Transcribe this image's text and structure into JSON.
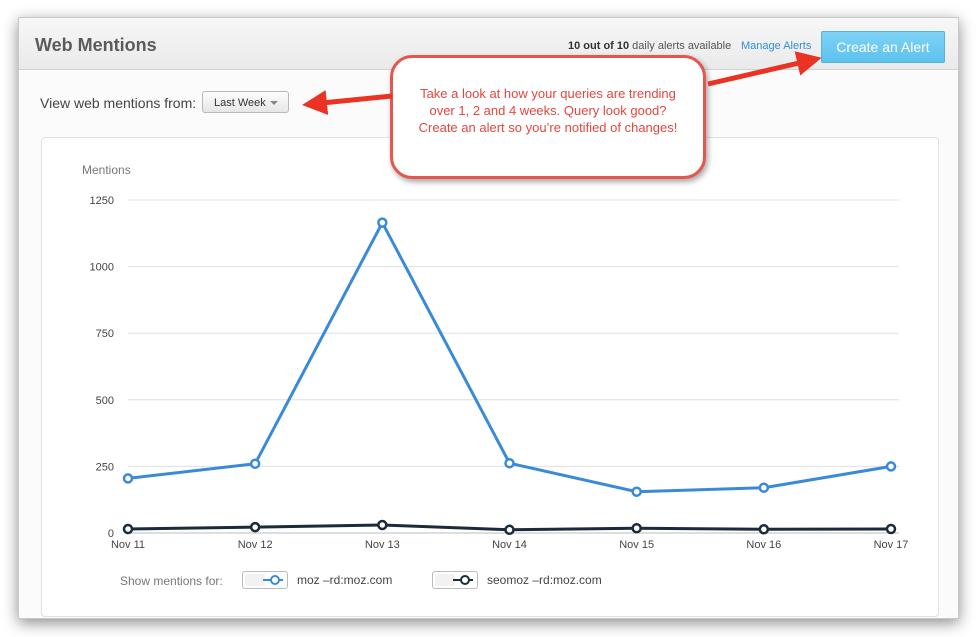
{
  "header": {
    "title": "Web Mentions",
    "quota_count": "10 out of 10",
    "quota_suffix": " daily alerts available",
    "manage_link": "Manage Alerts",
    "create_button": "Create an Alert"
  },
  "filter": {
    "label": "View web mentions from:",
    "selected": "Last Week"
  },
  "callout": {
    "text": "Take a look at how your queries are trending over 1, 2 and 4 weeks. Query look good? Create an alert so you’re notified of changes!"
  },
  "chart_data": {
    "type": "line",
    "title": "",
    "xlabel": "",
    "ylabel": "Mentions",
    "categories": [
      "Nov 11",
      "Nov 12",
      "Nov 13",
      "Nov 14",
      "Nov 15",
      "Nov 16",
      "Nov 17"
    ],
    "yticks": [
      "0",
      "250",
      "500",
      "750",
      "1000",
      "1250"
    ],
    "ylim": [
      0,
      1250
    ],
    "grid": true,
    "series": [
      {
        "name": "moz -rd:moz.com",
        "color": "#3b8ad8",
        "values": [
          205,
          260,
          1165,
          262,
          155,
          170,
          250
        ]
      },
      {
        "name": "seomoz -rd:moz.com",
        "color": "#1a2b3c",
        "values": [
          15,
          22,
          30,
          12,
          18,
          14,
          15
        ]
      }
    ]
  },
  "legend": {
    "label": "Show mentions for:",
    "items": [
      {
        "name": "moz –rd:moz.com",
        "color": "#3b8ad8",
        "icon": "toggle-switch-icon"
      },
      {
        "name": "seomoz –rd:moz.com",
        "color": "#1a2b3c",
        "icon": "toggle-switch-icon"
      }
    ]
  },
  "colors": {
    "accent": "#5cc2ee",
    "link": "#2f8fd6",
    "callout": "#e4574f",
    "arrow": "#ea3323"
  }
}
